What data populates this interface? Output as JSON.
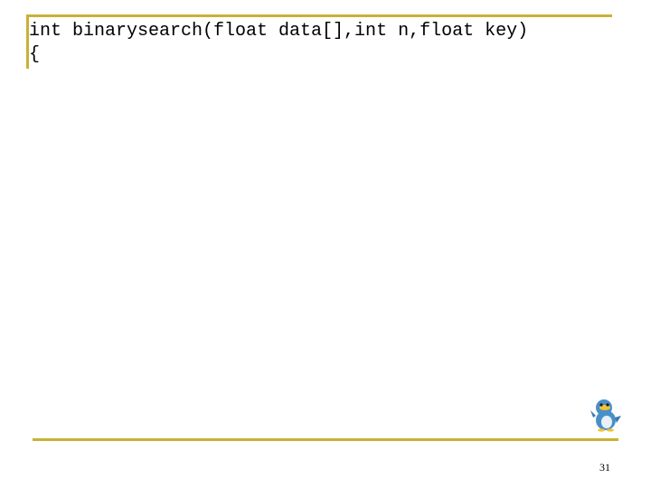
{
  "slide": {
    "code_lines": [
      "int binarysearch(float data[],int n,float key)",
      "{"
    ],
    "page_number": "31"
  },
  "colors": {
    "rule": "#c9b037",
    "mascot_body": "#4a90c8",
    "mascot_beak": "#f2c230"
  },
  "icons": {
    "mascot": "penguin-mascot-icon"
  }
}
